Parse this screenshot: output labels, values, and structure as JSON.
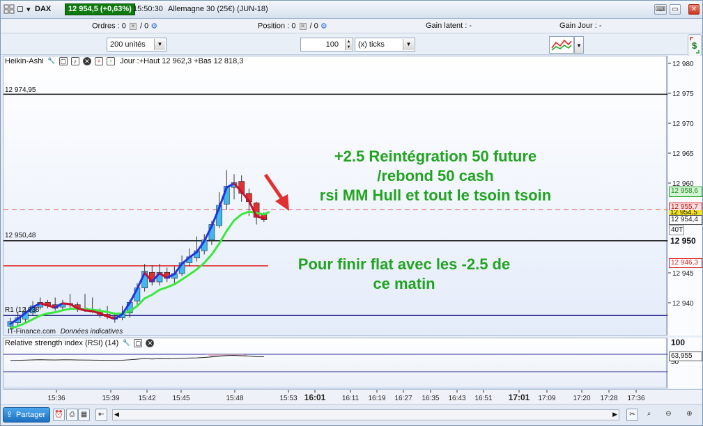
{
  "title": {
    "symbol": "DAX",
    "price": "12 954,5 (+0,63%)",
    "time": "15:50:30",
    "instrument": "Allemagne 30 (25€) (JUN-18)"
  },
  "info": {
    "orders_label": "Ordres :",
    "orders_value": "0",
    "orders_sep": "/ 0",
    "position_label": "Position :",
    "position_value": "0",
    "position_sep": "/ 0",
    "gain_latent_label": "Gain latent :",
    "gain_latent_value": "-",
    "gain_jour_label": "Gain Jour :",
    "gain_jour_value": "-"
  },
  "toolbar": {
    "units_select": "200 unités",
    "ticks_value": "100",
    "ticks_unit": "(x) ticks"
  },
  "chart_legend": {
    "name": "Heikin-Ashi",
    "info": "Jour :+Haut 12 962,3 +Bas 12 818,3"
  },
  "chart": {
    "level_1": "12 974,95",
    "level_2": "12 950,48",
    "pivot": "R1 (12 938",
    "watermark": "IT-Finance.com",
    "watermark_note": "Données indicatives",
    "annotation_1": [
      "+2.5 Reintégration 50 future",
      "/rebond 50 cash",
      "rsi MM Hull et tout le tsoin tsoin"
    ],
    "annotation_2": [
      "Pour finir flat avec les -2.5 de",
      "ce matin"
    ]
  },
  "y_axis": {
    "ticks": [
      "12 980",
      "12 975",
      "12 970",
      "12 965",
      "12 960",
      "12 955",
      "12 950",
      "12 945",
      "12 940"
    ],
    "tag_green": "12 958,6",
    "tag_red": "12 955,7",
    "tag_yellow": "12 954,5",
    "tag_current": "12 954,4",
    "tag_40t": "40T",
    "tag_bold": "12 950",
    "tag_red2": "12 946,3"
  },
  "rsi": {
    "label": "Relative strength index (RSI) (14)",
    "axis_100": "100",
    "axis_50": "50",
    "value": "63,955"
  },
  "x_axis": {
    "ticks": [
      "15:36",
      "15:39",
      "15:42",
      "15:45",
      "15:48",
      "15:53",
      "16:01",
      "16:11",
      "16:19",
      "16:27",
      "16:35",
      "16:43",
      "16:51",
      "17:01",
      "17:09",
      "17:20",
      "17:28",
      "17:36"
    ],
    "bold": [
      "16:01",
      "17:01"
    ]
  },
  "bottom": {
    "share_label": "Partager"
  },
  "colors": {
    "bull": "#3fb8f0",
    "bear": "#e03030",
    "hull_up": "#2233e0",
    "hull_down": "#c8102e",
    "ma": "#3de83d",
    "annotation": "#22a322",
    "price_badge": "#0f7a0f"
  },
  "chart_data": {
    "type": "candlestick",
    "candles": [
      {
        "o": 12936.2,
        "c": 12937.0,
        "h": 12937.6,
        "l": 12935.6
      },
      {
        "o": 12936.8,
        "c": 12937.6,
        "h": 12938.6,
        "l": 12936.2
      },
      {
        "o": 12937.4,
        "c": 12938.6,
        "h": 12939.4,
        "l": 12936.8
      },
      {
        "o": 12938.4,
        "c": 12939.6,
        "h": 12940.4,
        "l": 12938.0
      },
      {
        "o": 12939.4,
        "c": 12940.2,
        "h": 12941.0,
        "l": 12939.0
      },
      {
        "o": 12940.2,
        "c": 12939.6,
        "h": 12940.6,
        "l": 12939.2
      },
      {
        "o": 12939.8,
        "c": 12939.2,
        "h": 12941.0,
        "l": 12938.8
      },
      {
        "o": 12939.4,
        "c": 12940.0,
        "h": 12940.6,
        "l": 12938.8
      },
      {
        "o": 12939.8,
        "c": 12940.0,
        "h": 12941.6,
        "l": 12939.2
      },
      {
        "o": 12939.8,
        "c": 12939.2,
        "h": 12940.2,
        "l": 12938.6
      },
      {
        "o": 12939.2,
        "c": 12938.8,
        "h": 12941.6,
        "l": 12938.6
      },
      {
        "o": 12939.0,
        "c": 12938.6,
        "h": 12941.0,
        "l": 12938.4
      },
      {
        "o": 12938.8,
        "c": 12938.2,
        "h": 12939.2,
        "l": 12937.6
      },
      {
        "o": 12938.2,
        "c": 12937.8,
        "h": 12939.6,
        "l": 12937.4
      },
      {
        "o": 12937.8,
        "c": 12937.4,
        "h": 12938.2,
        "l": 12936.8
      },
      {
        "o": 12937.6,
        "c": 12938.2,
        "h": 12939.6,
        "l": 12937.2
      },
      {
        "o": 12938.4,
        "c": 12940.2,
        "h": 12940.6,
        "l": 12937.6
      },
      {
        "o": 12940.4,
        "c": 12942.6,
        "h": 12943.4,
        "l": 12939.6
      },
      {
        "o": 12942.6,
        "c": 12945.4,
        "h": 12946.6,
        "l": 12942.0
      },
      {
        "o": 12945.2,
        "c": 12943.6,
        "h": 12946.4,
        "l": 12943.0
      },
      {
        "o": 12943.6,
        "c": 12945.2,
        "h": 12946.6,
        "l": 12943.0
      },
      {
        "o": 12945.2,
        "c": 12944.2,
        "h": 12946.0,
        "l": 12943.6
      },
      {
        "o": 12944.2,
        "c": 12945.0,
        "h": 12946.2,
        "l": 12943.4
      },
      {
        "o": 12945.0,
        "c": 12946.8,
        "h": 12948.0,
        "l": 12944.6
      },
      {
        "o": 12946.8,
        "c": 12947.8,
        "h": 12949.2,
        "l": 12946.2
      },
      {
        "o": 12947.6,
        "c": 12948.8,
        "h": 12951.2,
        "l": 12947.0
      },
      {
        "o": 12948.8,
        "c": 12950.6,
        "h": 12951.6,
        "l": 12948.2
      },
      {
        "o": 12950.6,
        "c": 12953.2,
        "h": 12953.8,
        "l": 12949.8
      },
      {
        "o": 12953.0,
        "c": 12956.4,
        "h": 12958.6,
        "l": 12952.6
      },
      {
        "o": 12956.6,
        "c": 12959.6,
        "h": 12962.3,
        "l": 12955.6
      },
      {
        "o": 12959.4,
        "c": 12960.2,
        "h": 12961.6,
        "l": 12957.4
      },
      {
        "o": 12960.4,
        "c": 12958.4,
        "h": 12961.4,
        "l": 12957.0
      },
      {
        "o": 12958.4,
        "c": 12957.0,
        "h": 12959.2,
        "l": 12954.6
      },
      {
        "o": 12956.8,
        "c": 12954.4,
        "h": 12957.0,
        "l": 12953.2
      },
      {
        "o": 12954.8,
        "c": 12954.0,
        "h": 12955.2,
        "l": 12953.6
      }
    ],
    "levels": [
      12974.95,
      12950.48,
      12946.3,
      12938.0
    ],
    "dashed_level": 12955.7,
    "ylim": [
      12935,
      12982
    ]
  }
}
